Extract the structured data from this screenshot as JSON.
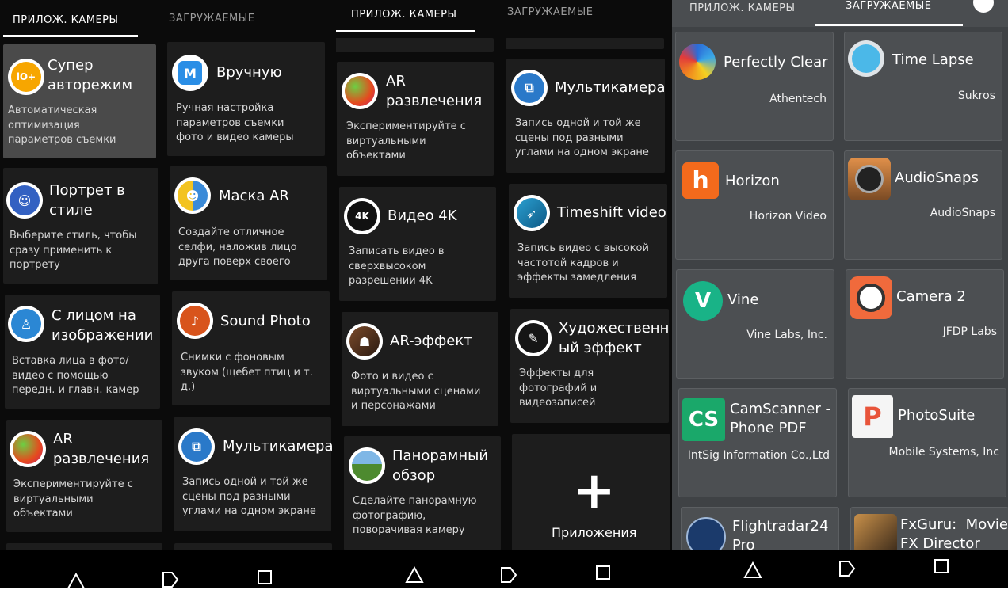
{
  "tabs": {
    "camera_apps": "ПРИЛОЖ. КАМЕРЫ",
    "downloaded": "ЗАГРУЖАЕМЫЕ"
  },
  "panel1": {
    "tiles": [
      {
        "title": "Супер\nавторежим",
        "desc": "Автоматическая\nоптимизация\nпараметров съемки"
      },
      {
        "title": "Вручную",
        "desc": "Ручная настройка\nпараметров съемки\nфото и видео камеры"
      },
      {
        "title": "Портрет в\nстиле",
        "desc": "Выберите стиль, чтобы\nсразу применить к\nпортрету"
      },
      {
        "title": "Маска AR",
        "desc": "Создайте отличное\nселфи, наложив лицо\nдруга поверх своего"
      },
      {
        "title": "С лицом на\nизображении",
        "desc": "Вставка лица в фото/\nвидео с помощью\nпередн. и главн. камер"
      },
      {
        "title": "Sound Photo",
        "desc": "Снимки с фоновым\nзвуком (щебет птиц и т.\nд.)"
      },
      {
        "title": "AR\nразвлечения",
        "desc": "Экспериментируйте с\nвиртуальными\nобъектами"
      },
      {
        "title": "Мультикамера",
        "desc": "Запись одной и той же\nсцены под разными\nуглами на одном экране"
      }
    ]
  },
  "panel2": {
    "tiles": [
      {
        "title": "AR\nразвлечения",
        "desc": "Экспериментируйте с\nвиртуальными\nобъектами"
      },
      {
        "title": "Мультикамера",
        "desc": "Запись одной и той же\nсцены под разными\nуглами на одном экране"
      },
      {
        "title": "Видео 4K",
        "desc": "Записать видео в\nсверхвысоком\nразрешении 4K"
      },
      {
        "title": "Timeshift video",
        "desc": "Запись видео с высокой\nчастотой кадров и\nэффекты замедления"
      },
      {
        "title": "AR-эффект",
        "desc": "Фото и видео с\nвиртуальными сценами\nи персонажами"
      },
      {
        "title": "Художественн\nый эффект",
        "desc": "Эффекты для\nфотографий и\nвидеозаписей"
      },
      {
        "title": "Панорамный\nобзор",
        "desc": "Сделайте панорамную\nфотографию,\nповорачивая камеру"
      }
    ],
    "add_label": "Приложения"
  },
  "panel3": {
    "apps": [
      {
        "name": "Perfectly Clear",
        "dev": "Athentech"
      },
      {
        "name": "Time Lapse",
        "dev": "Sukros"
      },
      {
        "name": "Horizon",
        "dev": "Horizon Video"
      },
      {
        "name": "AudioSnaps",
        "dev": "AudioSnaps"
      },
      {
        "name": "Vine",
        "dev": "Vine Labs, Inc."
      },
      {
        "name": "Camera 2",
        "dev": "JFDP Labs"
      },
      {
        "name": "CamScanner -\nPhone PDF",
        "dev": "IntSig Information Co.,Ltd"
      },
      {
        "name": "PhotoSuite",
        "dev": "Mobile Systems, Inc"
      },
      {
        "name": "Flightradar24\nPro",
        "dev": ""
      },
      {
        "name": "FxGuru:  Movie\nFX Director",
        "dev": ""
      }
    ]
  },
  "icons": {
    "vine_glyph": "V",
    "horizon_glyph": "h",
    "camscanner_glyph": "CS",
    "photosuite_glyph": "P",
    "video4k_glyph": "4K",
    "manual_glyph": "M"
  },
  "colors": {
    "panel_bg": "#0b0b0b",
    "tile_bg": "#1d1d1d",
    "selected_tile_bg": "#4a4a4a",
    "downloads_bg": "#3f4245",
    "card_bg": "#4c4f52"
  }
}
